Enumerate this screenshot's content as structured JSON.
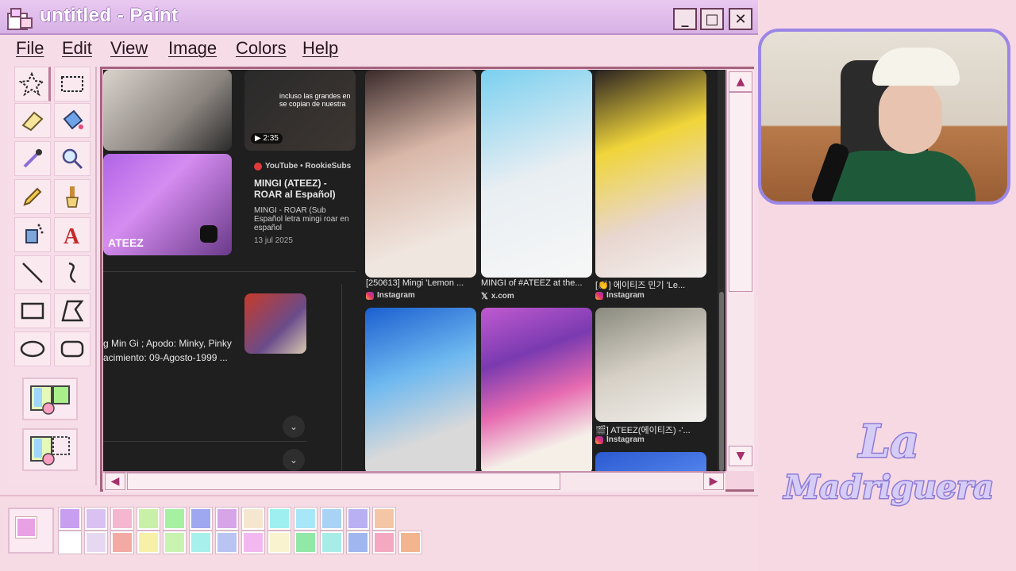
{
  "window": {
    "title": "untitled - Paint",
    "minimize": "_",
    "maximize": "□",
    "close": "✕"
  },
  "menu": [
    "File",
    "Edit",
    "View",
    "Image",
    "Colors",
    "Help"
  ],
  "browser": {
    "video_badge": "▶ 2:35",
    "video_overlay": "incluso las grandes en se copian de nuestra",
    "video_source": "YouTube • RookieSubs",
    "video_title": "MINGI (ATEEZ) - ROAR al Español)",
    "video_desc": "MINGI - ROAR (Sub Español letra mingi roar en español",
    "video_date": "13 jul 2025",
    "thumb_caption": "ATEEZ",
    "info_line1": "g Min Gi ; Apodo: Minky, Pinky",
    "info_line2": "acimiento: 09-Agosto-1999 ...",
    "results": [
      {
        "caption": "[250613] Mingi 'Lemon ...",
        "source": "Instagram"
      },
      {
        "caption": "MINGI of #ATEEZ at the...",
        "source": "x.com"
      },
      {
        "caption": "[👏] 에이티즈 민기 'Le...",
        "source": "Instagram"
      },
      {
        "caption": "🎬] ATEEZ(에이티즈) -'...",
        "source": "Instagram"
      }
    ]
  },
  "palette": {
    "current_fg": "#e9a1e6",
    "top_row": [
      "#c79ef0",
      "#d9c1f2",
      "#f4b7cf",
      "#c9f0a8",
      "#a6f0a2",
      "#9ea8f0",
      "#d7a4e8",
      "#f5e7cf",
      "#9ef0f0",
      "#a8e7f7",
      "#a9d3f5",
      "#b8b0f2",
      "#f5c6a6"
    ],
    "bottom_row": [
      "#ffffff",
      "#e7d8f2",
      "#f3a9a4",
      "#f6f0a8",
      "#c8f3b0",
      "#a8f0ec",
      "#b9c4f3",
      "#f2b9f0",
      "#faf3cf",
      "#92e8a6",
      "#a8ece8",
      "#9fb6ee",
      "#f5a8c2",
      "#f2b58e"
    ]
  },
  "stream_logo": {
    "line1": "La",
    "line2": "Madriguera"
  }
}
